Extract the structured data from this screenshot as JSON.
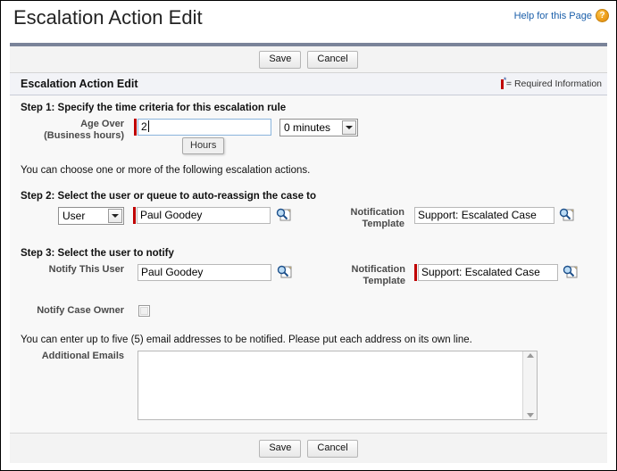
{
  "page": {
    "title": "Escalation Action Edit",
    "help_link": "Help for this Page",
    "help_icon": "question-mark-circle-icon"
  },
  "toolbar_top": {
    "save_label": "Save",
    "cancel_label": "Cancel"
  },
  "toolbar_bottom": {
    "save_label": "Save",
    "cancel_label": "Cancel"
  },
  "section": {
    "header_title": "Escalation Action Edit",
    "required_legend": "= Required Information",
    "required_color": "#c00000"
  },
  "step1": {
    "heading": "Step 1: Specify the time criteria for this escalation rule",
    "age_over_label_line1": "Age Over",
    "age_over_label_line2": "(Business hours)",
    "age_over_value": "2",
    "age_over_required": true,
    "minutes_select_value": "0 minutes",
    "tooltip": "Hours"
  },
  "info_text": "You can choose one or more of the following escalation actions.",
  "step2": {
    "heading": "Step 2: Select the user or queue to auto-reassign the case to",
    "type_select_value": "User",
    "assignee_value": "Paul Goodey",
    "assignee_required": true,
    "assignee_lookup_icon": "lookup-magnifier-icon",
    "notification_label_line1": "Notification",
    "notification_label_line2": "Template",
    "notification_value": "Support: Escalated Case",
    "notification_required": false,
    "notification_lookup_icon": "lookup-magnifier-icon"
  },
  "step3": {
    "heading": "Step 3: Select the user to notify",
    "notify_user_label": "Notify This User",
    "notify_user_value": "Paul Goodey",
    "notify_user_lookup_icon": "lookup-magnifier-icon",
    "notification_label_line1": "Notification",
    "notification_label_line2": "Template",
    "notification_value": "Support: Escalated Case",
    "notification_required": true,
    "notification_lookup_icon": "lookup-magnifier-icon",
    "notify_case_owner_label": "Notify Case Owner",
    "notify_case_owner_checked": false
  },
  "emails": {
    "hint": "You can enter up to five (5) email addresses to be notified. Please put each address on its own line.",
    "label": "Additional Emails",
    "value": "",
    "scroll_up_icon": "scroll-up-arrow-icon",
    "scroll_down_icon": "scroll-down-arrow-icon"
  }
}
